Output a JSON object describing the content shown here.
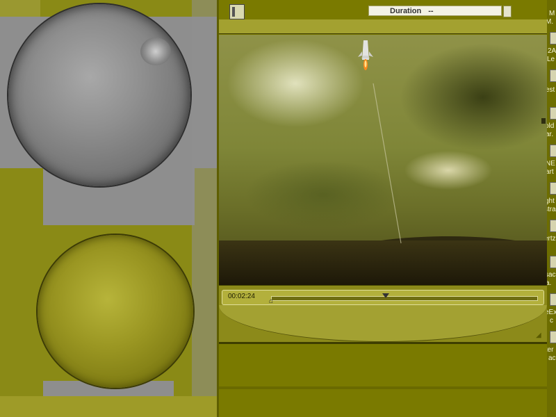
{
  "player": {
    "duration_label": "Duration",
    "duration_value": "--",
    "current_time": "00:02:24",
    "progress": 0.43
  },
  "icons": {
    "window": "movie-window-icon",
    "playhead": "playhead-icon",
    "in_marker": "in-point-marker-icon",
    "resize": "resize-grip-icon"
  },
  "desktop_items": [
    {
      "label": "M"
    },
    {
      "label": "M."
    },
    {
      "label": "2A"
    },
    {
      "label": "Le"
    },
    {
      "label": "est"
    },
    {
      "label": "old"
    },
    {
      "label": "ar."
    },
    {
      "label": "NE"
    },
    {
      "label": "art"
    },
    {
      "label": "ght"
    },
    {
      "label": "stra"
    },
    {
      "label": "ertz"
    },
    {
      "label": "sac"
    },
    {
      "label": "a."
    },
    {
      "label": "eEx"
    },
    {
      "label": "c"
    },
    {
      "label": "inter"
    },
    {
      "label": "ac"
    }
  ],
  "colors": {
    "accent": "#a3a130",
    "desktop": "#7a7a00"
  }
}
